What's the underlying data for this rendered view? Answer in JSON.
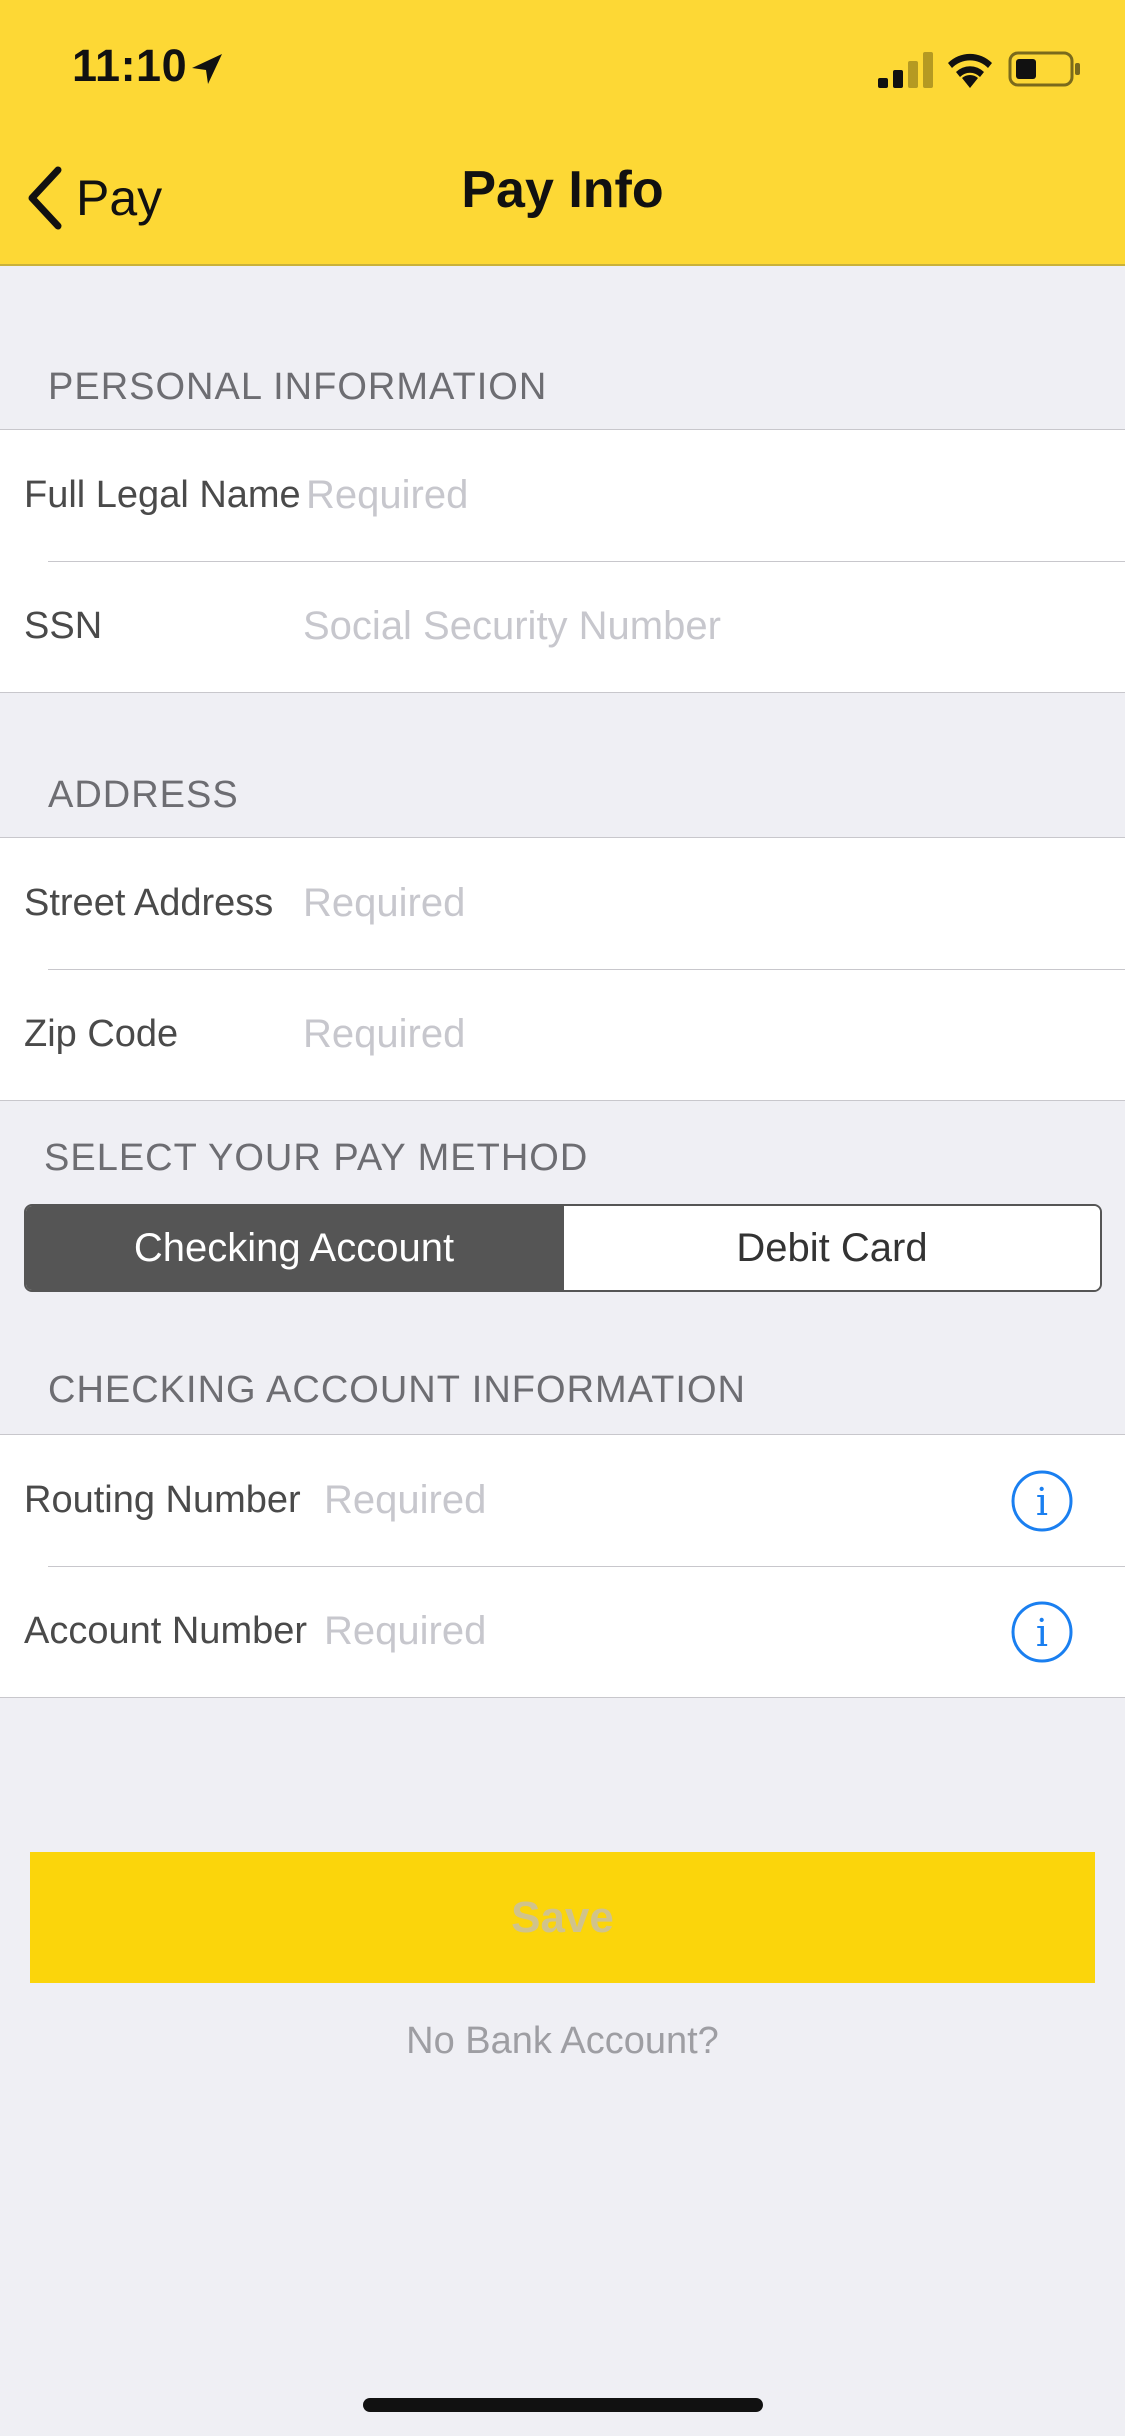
{
  "status_bar": {
    "time": "11:10"
  },
  "nav": {
    "back_label": "Pay",
    "title": "Pay Info"
  },
  "personal": {
    "header": "PERSONAL INFORMATION",
    "full_name_label": "Full Legal Name",
    "full_name_placeholder": "Required",
    "ssn_label": "SSN",
    "ssn_placeholder": "Social Security Number"
  },
  "address": {
    "header": "ADDRESS",
    "street_label": "Street Address",
    "street_placeholder": "Required",
    "zip_label": "Zip Code",
    "zip_placeholder": "Required"
  },
  "pay_method": {
    "header": "SELECT YOUR PAY METHOD",
    "options": [
      "Checking Account",
      "Debit Card"
    ],
    "selected": "Checking Account"
  },
  "checking": {
    "header": "CHECKING ACCOUNT INFORMATION",
    "routing_label": "Routing Number",
    "routing_placeholder": "Required",
    "account_label": "Account Number",
    "account_placeholder": "Required"
  },
  "actions": {
    "save_label": "Save",
    "no_bank_label": "No Bank Account?"
  },
  "colors": {
    "header_bg": "#fdd835",
    "save_bg": "#fbd50b",
    "info_icon": "#1a7ff0",
    "segment_active": "#555555"
  }
}
